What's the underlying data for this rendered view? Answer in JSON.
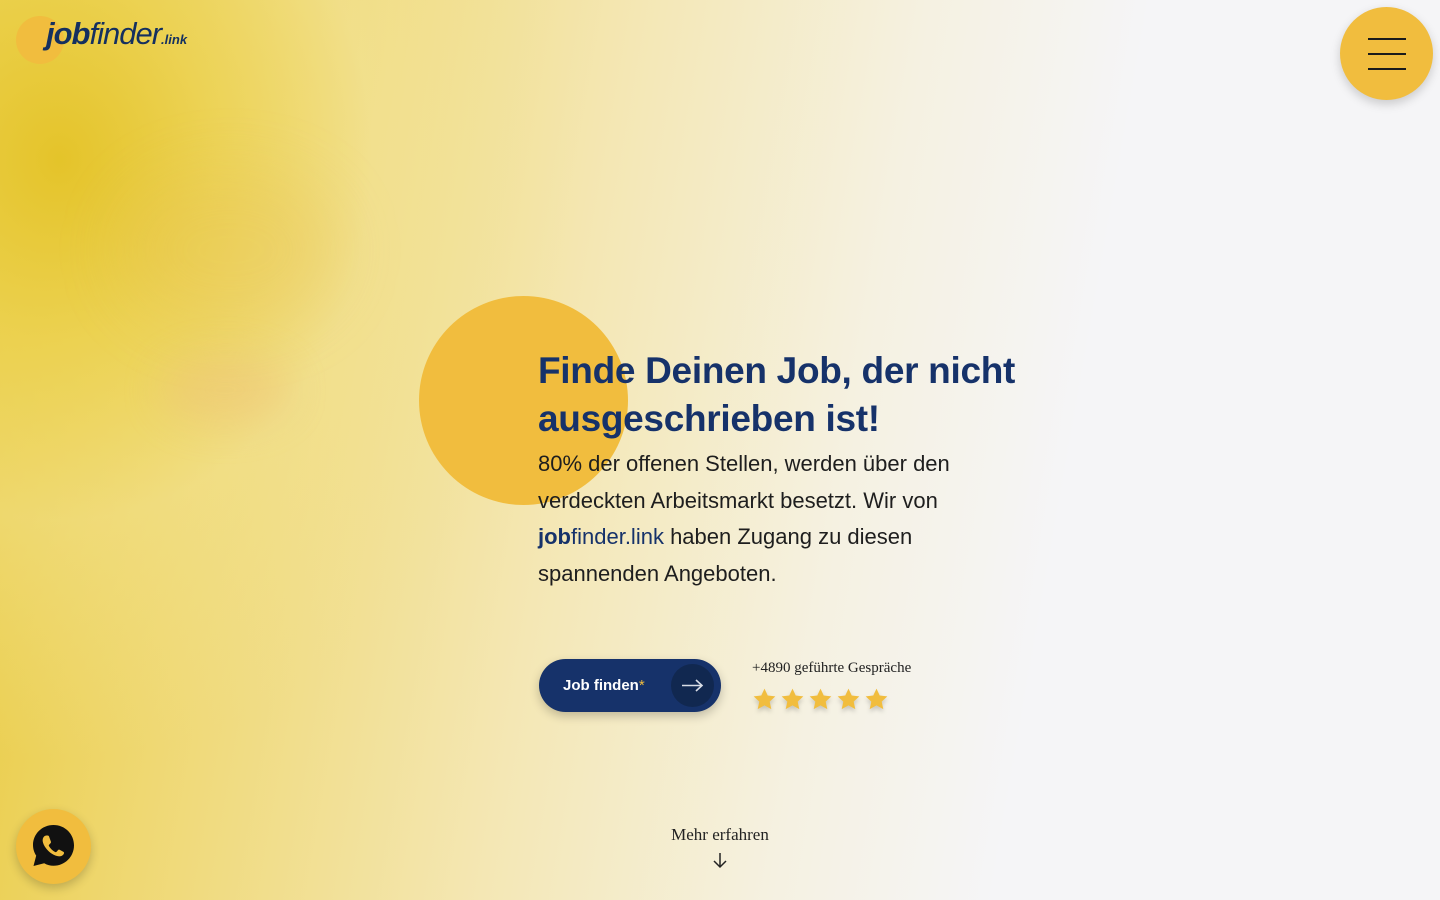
{
  "header": {
    "logo": {
      "job": "job",
      "finder": "finder",
      "tld": ".link"
    },
    "menu_icon": "hamburger-menu-icon"
  },
  "hero": {
    "headline": "Finde Deinen Job, der nicht ausgeschrieben ist!",
    "intro_before": "80% der offenen Stellen, werden über den verdeckten Arbeitsmarkt besetzt. Wir von ",
    "intro_brand_bold": "job",
    "intro_brand_rest": "finder.link",
    "intro_after": " haben Zugang zu diesen spannenden Angeboten."
  },
  "cta": {
    "label": "Job finden",
    "asterisk": "*",
    "icon": "arrow-right-icon"
  },
  "rating": {
    "text": "+4890 geführte Gespräche",
    "stars": 5,
    "star_color": "#f1bd3e"
  },
  "more": {
    "label": "Mehr erfahren",
    "icon": "arrow-down-icon"
  },
  "whatsapp": {
    "icon": "whatsapp-icon"
  },
  "colors": {
    "accent": "#f1bd3e",
    "brand": "#16326a",
    "background": "#f5f5f7"
  }
}
